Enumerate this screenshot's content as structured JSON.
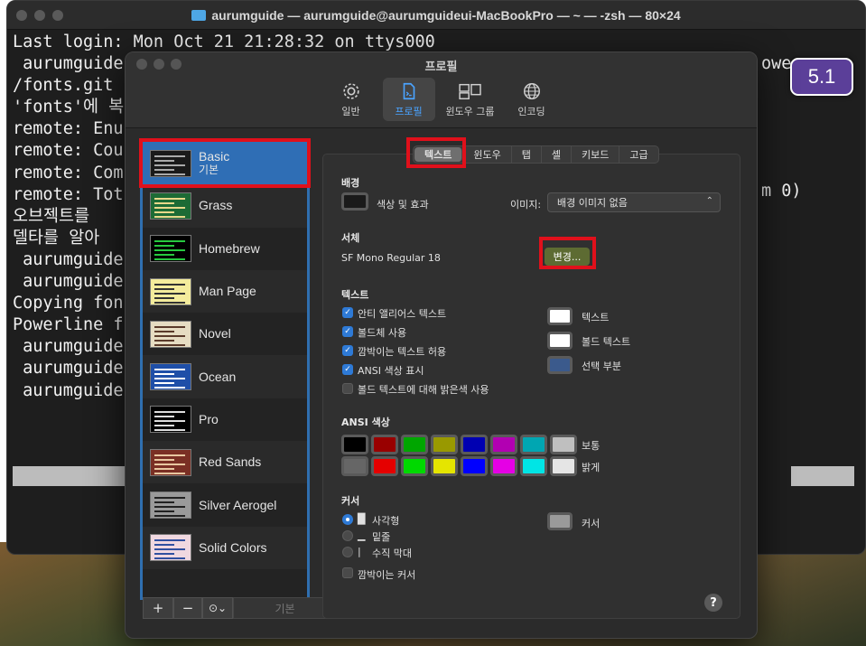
{
  "terminal": {
    "title": "aurumguide — aurumguide@aurumguideui-MacBookPro — ~ — -zsh — 80×24",
    "lines": [
      "Last login: Mon Oct 21 21:28:32 on ttys000",
      " aurumguide",
      "/fonts.git",
      "'fonts'에 복",
      "remote: Enu",
      "remote: Cou",
      "remote: Com",
      "remote: Tot",
      "오브젝트를",
      "델타를 알아",
      " aurumguide",
      " aurumguide",
      "Copying fon",
      "Powerline f",
      " aurumguide",
      " aurumguide",
      " aurumguide"
    ],
    "right_fragments": {
      "line2": "owe",
      "line8": "m 0)"
    }
  },
  "badge": {
    "label": "5.1"
  },
  "prefs": {
    "title": "프로필",
    "toolbar": [
      {
        "label": "일반",
        "icon": "gear-icon"
      },
      {
        "label": "프로필",
        "icon": "document-icon",
        "active": true
      },
      {
        "label": "윈도우 그룹",
        "icon": "windows-icon"
      },
      {
        "label": "인코딩",
        "icon": "globe-icon"
      }
    ],
    "profiles": [
      {
        "name": "Basic",
        "sub": "기본",
        "selected": true,
        "bg": "#1a1a1a",
        "lines": "#aaaaaa"
      },
      {
        "name": "Grass",
        "bg": "#1d6b35",
        "lines": "#e8d88a"
      },
      {
        "name": "Homebrew",
        "bg": "#000000",
        "lines": "#27c93f"
      },
      {
        "name": "Man Page",
        "bg": "#f4ec9c",
        "lines": "#333333"
      },
      {
        "name": "Novel",
        "bg": "#e6dcc2",
        "lines": "#5a3a2a"
      },
      {
        "name": "Ocean",
        "bg": "#1f4fa8",
        "lines": "#ffffff"
      },
      {
        "name": "Pro",
        "bg": "#000000",
        "lines": "#dddddd"
      },
      {
        "name": "Red Sands",
        "bg": "#7a2f24",
        "lines": "#e8c7a0"
      },
      {
        "name": "Silver Aerogel",
        "bg": "#9a9a9a",
        "lines": "#222222"
      },
      {
        "name": "Solid Colors",
        "bg": "#f0d8e0",
        "lines": "#3050a0"
      }
    ],
    "footer": {
      "add": "+",
      "remove": "−",
      "more": "⊙⌄",
      "default": "기본"
    },
    "tabs": [
      "텍스트",
      "윈도우",
      "탭",
      "셸",
      "키보드",
      "고급"
    ],
    "background": {
      "title": "배경",
      "color_effects": "색상 및 효과",
      "image_label": "이미지:",
      "image_value": "배경 이미지 없음"
    },
    "font": {
      "title": "서체",
      "value": "SF Mono Regular 18",
      "change": "변경..."
    },
    "text": {
      "title": "텍스트",
      "options": [
        {
          "label": "안티 앨리어스 텍스트",
          "checked": true
        },
        {
          "label": "볼드체 사용",
          "checked": true
        },
        {
          "label": "깜박이는 텍스트 허용",
          "checked": true
        },
        {
          "label": "ANSI 색상 표시",
          "checked": true
        },
        {
          "label": "볼드 텍스트에 대해 밝은색 사용",
          "checked": false
        }
      ],
      "colors": [
        {
          "label": "텍스트",
          "color": "#ffffff"
        },
        {
          "label": "볼드 텍스트",
          "color": "#ffffff"
        },
        {
          "label": "선택 부분",
          "color": "#3b5a8c"
        }
      ]
    },
    "ansi": {
      "title": "ANSI 색상",
      "normal_label": "보통",
      "bright_label": "밝게",
      "normal": [
        "#000000",
        "#990000",
        "#00a600",
        "#999900",
        "#0000b2",
        "#b200b2",
        "#00a6b2",
        "#bfbfbf"
      ],
      "bright": [
        "#666666",
        "#e50000",
        "#00d900",
        "#e5e500",
        "#0000ff",
        "#e500e5",
        "#00e5e5",
        "#e5e5e5"
      ]
    },
    "cursor": {
      "title": "커서",
      "options": [
        {
          "glyph": "█",
          "label": "사각형",
          "selected": true
        },
        {
          "glyph": "▁",
          "label": "밑줄",
          "selected": false
        },
        {
          "glyph": "|",
          "label": "수직 막대",
          "selected": false
        }
      ],
      "blink": "깜박이는 커서",
      "color_label": "커서",
      "color": "#9a9a9a"
    },
    "help": "?"
  }
}
